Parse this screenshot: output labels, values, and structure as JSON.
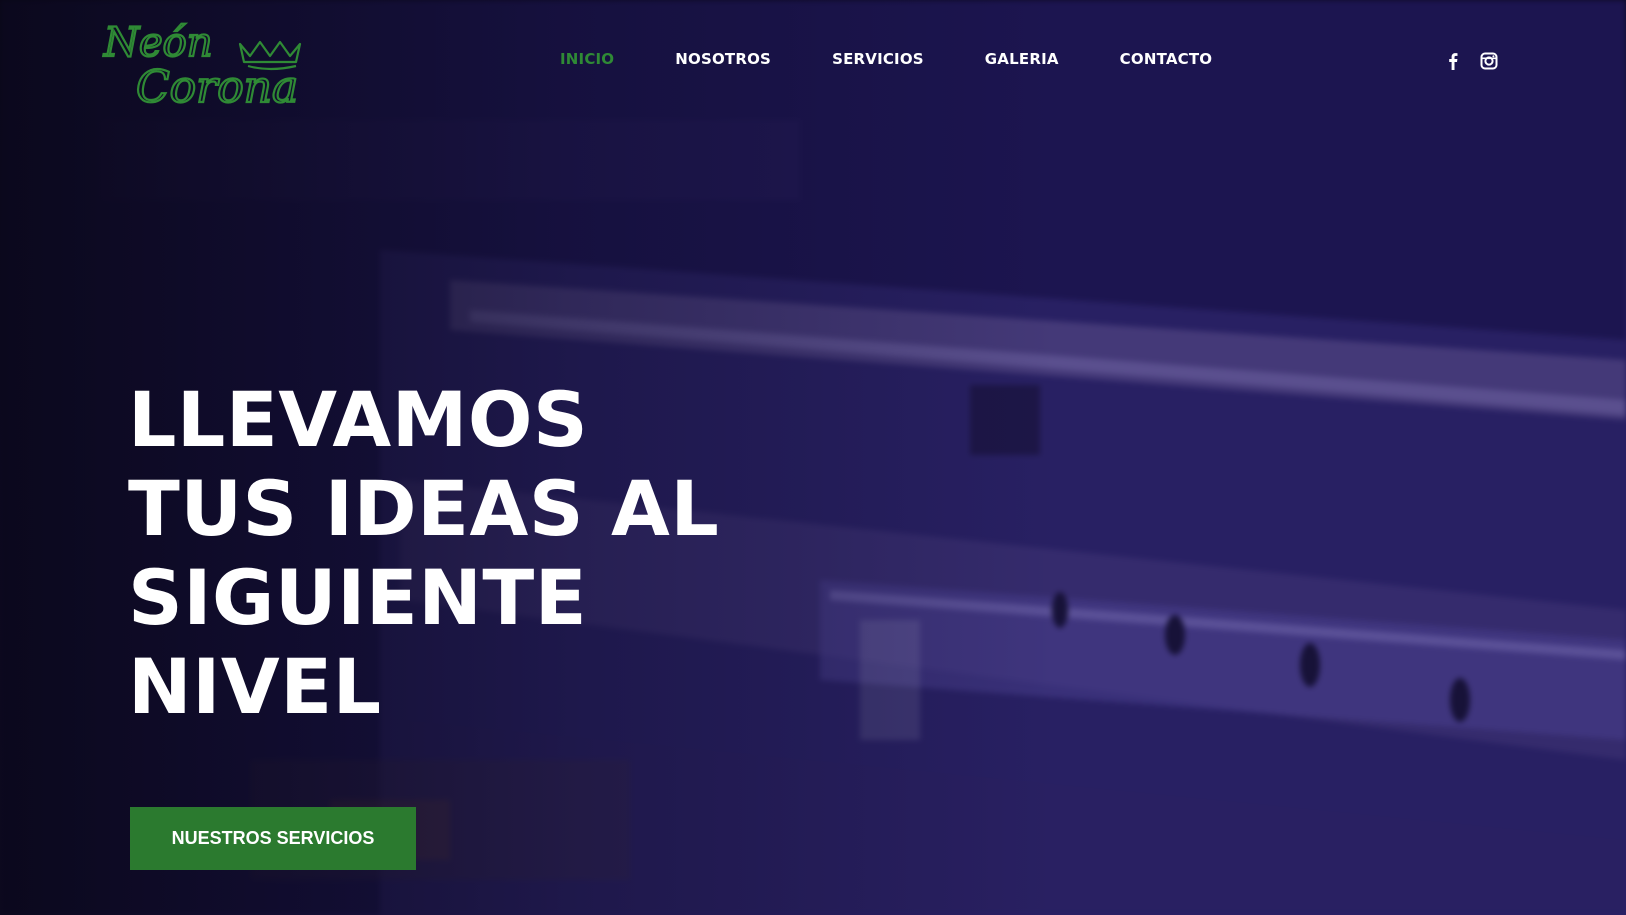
{
  "brand": {
    "logo_line1": "Neón",
    "logo_line2": "Corona",
    "logo_color": "#2f8a35"
  },
  "nav": {
    "items": [
      {
        "label": "INICIO",
        "active": true
      },
      {
        "label": "NOSOTROS",
        "active": false
      },
      {
        "label": "SERVICIOS",
        "active": false
      },
      {
        "label": "GALERIA",
        "active": false
      },
      {
        "label": "CONTACTO",
        "active": false
      }
    ],
    "active_color": "#2f8a35",
    "text_color": "#ffffff"
  },
  "social": {
    "icons": [
      "facebook-icon",
      "instagram-icon"
    ]
  },
  "hero": {
    "headline_lines": [
      "LLEVAMOS",
      "TUS IDEAS AL",
      "SIGUIENTE",
      "NIVEL"
    ],
    "cta_label": "NUESTROS SERVICIOS",
    "cta_color": "#2b7a2f",
    "overlay_color": "#231a5c"
  }
}
